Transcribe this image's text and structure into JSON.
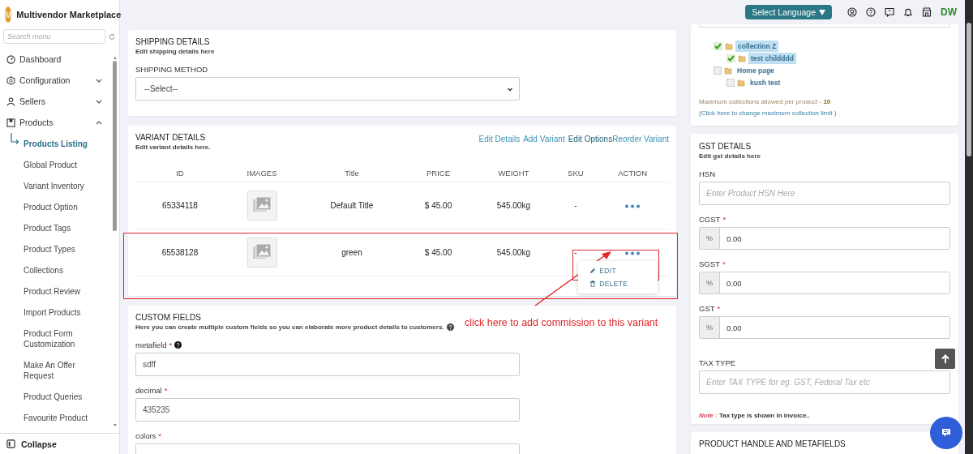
{
  "brand": {
    "initial": "M",
    "name": "Multivendor Marketplace"
  },
  "sidebar": {
    "search_placeholder": "Search menu",
    "items": [
      {
        "label": "Dashboard"
      },
      {
        "label": "Configuration",
        "expanded": false
      },
      {
        "label": "Sellers",
        "expanded": false
      },
      {
        "label": "Products",
        "expanded": true,
        "children": [
          {
            "label": "Products Listing",
            "selected": true
          },
          {
            "label": "Global Product",
            "selected": false
          },
          {
            "label": "Variant Inventory",
            "selected": false
          },
          {
            "label": "Product Option",
            "selected": false
          },
          {
            "label": "Product Tags",
            "selected": false
          },
          {
            "label": "Product Types",
            "selected": false
          },
          {
            "label": "Collections",
            "selected": false
          },
          {
            "label": "Product Review",
            "selected": false
          },
          {
            "label": "Import Products",
            "selected": false
          },
          {
            "label": "Product Form Customization",
            "selected": false
          },
          {
            "label": "Make An Offer Request",
            "selected": false
          },
          {
            "label": "Product Queries",
            "selected": false
          },
          {
            "label": "Favourite Product",
            "selected": false
          }
        ]
      }
    ],
    "collapse": "Collapse"
  },
  "header": {
    "language_button": "Select Language",
    "user_initials": "DW"
  },
  "shipping": {
    "title": "SHIPPING DETAILS",
    "subtitle": "Edit shipping details here",
    "method_label": "SHIPPING METHOD",
    "method_value": "--Select--"
  },
  "variants": {
    "title": "VARIANT DETAILS",
    "subtitle": "Edit variant details here.",
    "links": [
      {
        "label": "Edit Details",
        "hovered": false
      },
      {
        "label": "Add Variant",
        "hovered": false
      },
      {
        "label": "Edit Options",
        "hovered": true
      },
      {
        "label": "Reorder Variant",
        "hovered": false
      }
    ],
    "columns": [
      "ID",
      "IMAGES",
      "Title",
      "PRICE",
      "WEIGHT",
      "SKU",
      "ACTION"
    ],
    "rows": [
      {
        "id": "65334118",
        "title": "Default Title",
        "price": "$ 45.00",
        "weight": "545.00kg",
        "sku": "-",
        "menu_open": false
      },
      {
        "id": "65538128",
        "title": "green",
        "price": "$ 45.00",
        "weight": "545.00kg",
        "sku": "-",
        "menu_open": true
      }
    ],
    "menu": [
      {
        "label": "EDIT"
      },
      {
        "label": "DELETE"
      }
    ]
  },
  "annotation": {
    "text": "click here to add commission to this variant"
  },
  "custom_fields": {
    "title": "CUSTOM FIELDS",
    "subtitle": "Here you can create multiple custom fields so you can elaborate more product details to customers.",
    "fields": [
      {
        "label": "metafield",
        "required_mark": "*",
        "help": true,
        "value": "sdff"
      },
      {
        "label": "decimal",
        "required_mark": "*",
        "help": false,
        "value": "435235"
      },
      {
        "label": "colors",
        "required_mark": "*",
        "help": false
      }
    ]
  },
  "collections": {
    "tree": [
      {
        "label": "collection Z",
        "checked": true,
        "selected": true,
        "children": [
          {
            "label": "test childddd",
            "checked": true,
            "selected": true
          }
        ]
      },
      {
        "label": "Home page",
        "checked": false,
        "selected": false,
        "children": [
          {
            "label": "kush test",
            "checked": false,
            "selected": false
          }
        ]
      }
    ],
    "note": "Maximum collections allowed per product - ",
    "limit": "10",
    "link": "(Click here to change maximum collection limit )"
  },
  "gst": {
    "title": "GST DETAILS",
    "subtitle": "Edit gst details here",
    "fields": [
      {
        "kind": "text",
        "label": "HSN",
        "placeholder": "Enter Product HSN Here"
      },
      {
        "kind": "percent",
        "label": "CGST",
        "required_mark": "*",
        "addon": "%",
        "value": "0.00"
      },
      {
        "kind": "percent",
        "label": "SGST",
        "required_mark": "*",
        "addon": "%",
        "value": "0.00"
      },
      {
        "kind": "percent",
        "label": "GST",
        "required_mark": "*",
        "addon": "%",
        "value": "0.00"
      },
      {
        "kind": "text",
        "label": "TAX TYPE",
        "placeholder": "Enter TAX TYPE for eg. GST, Federal Tax etc"
      }
    ],
    "note_label": "Note :",
    "note": "Tax type is shown in invoice.."
  },
  "handle": {
    "title": "PRODUCT HANDLE AND METAFIELDS"
  }
}
